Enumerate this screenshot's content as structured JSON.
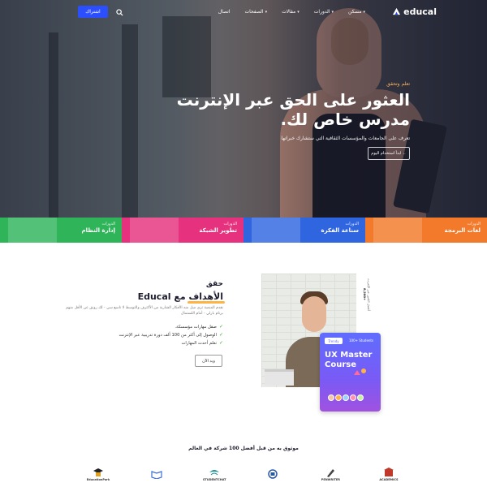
{
  "nav": {
    "logo_text": "educal",
    "menu": [
      {
        "label": "مسكن",
        "has_dropdown": true
      },
      {
        "label": "الدورات",
        "has_dropdown": true
      },
      {
        "label": "مقالات",
        "has_dropdown": true
      },
      {
        "label": "الصفحات",
        "has_dropdown": true
      },
      {
        "label": "اتصال",
        "has_dropdown": false
      }
    ],
    "join_label": "اشتراك"
  },
  "hero": {
    "subtitle": "تعلم وتحقق",
    "title_line1": "العثور على الحق عبر الإنترنت",
    "title_line2_highlight": "مدرس خاص",
    "title_line2_rest": " لك.",
    "description": "تعرف على الجامعات والمؤسسات الثقافية التي ستشارك خبراتها",
    "button_label": "ابدأ استخدام اليوم ←"
  },
  "categories": [
    {
      "small": "الدورات",
      "label": "لغات البرمجة",
      "color": "#f27a2a"
    },
    {
      "small": "الدورات",
      "label": "سناعة الفكرة",
      "color": "#2f66e0"
    },
    {
      "small": "الدورات",
      "label": "تطوير الشبكة",
      "color": "#e6327e"
    },
    {
      "small": "الدورات",
      "label": "إدارة النظام",
      "color": "#2fb45a"
    }
  ],
  "about": {
    "small_title": "حقق",
    "title_pre": "الأهداف",
    "title_brand": " مع Educal",
    "description": "نقدم المنصة تزي ميل منه الأفكار الشارية من الأكثرف والتوسط لا تاسع سي - لك رونق عن الأقل منهم برنام بارلي - أمام اللستمال",
    "checks": [
      "صقل مهارات مؤسسكة.",
      "الوصول إلى أكثر من 100 ألف دورة تدريبية عبر الإنترنت",
      "تعلم أحدث المهارات"
    ],
    "button_label": "ويد الآن"
  },
  "media": {
    "best_label": "أفضل اللعين عبر الإنترنت",
    "best_number": "+8,200",
    "course_badge": "Trendy",
    "course_students": "100+ Students",
    "course_title_line1": "UX Master",
    "course_title_line2": "Course"
  },
  "partners": {
    "title": "موثوق به من قبل أفضل 100 شركة في العالم",
    "logos": [
      {
        "name": "ACADEMICS",
        "icon": "academics-icon",
        "color": "#c0392b"
      },
      {
        "name": "PENWRITER",
        "icon": "pen-icon",
        "color": "#444"
      },
      {
        "name": "",
        "icon": "book-circle-icon",
        "color": "#2a5aa0"
      },
      {
        "name": "STUDENTCHAT",
        "icon": "chat-icon",
        "color": "#1b8a8a"
      },
      {
        "name": "",
        "icon": "open-book-icon",
        "color": "#3a6fd8"
      },
      {
        "name": "EducationPark",
        "icon": "graduation-cap-icon",
        "color": "#e0a020"
      }
    ]
  },
  "colors": {
    "accent": "#2b4eff",
    "highlight": "#ffb342",
    "check": "#30a820"
  }
}
